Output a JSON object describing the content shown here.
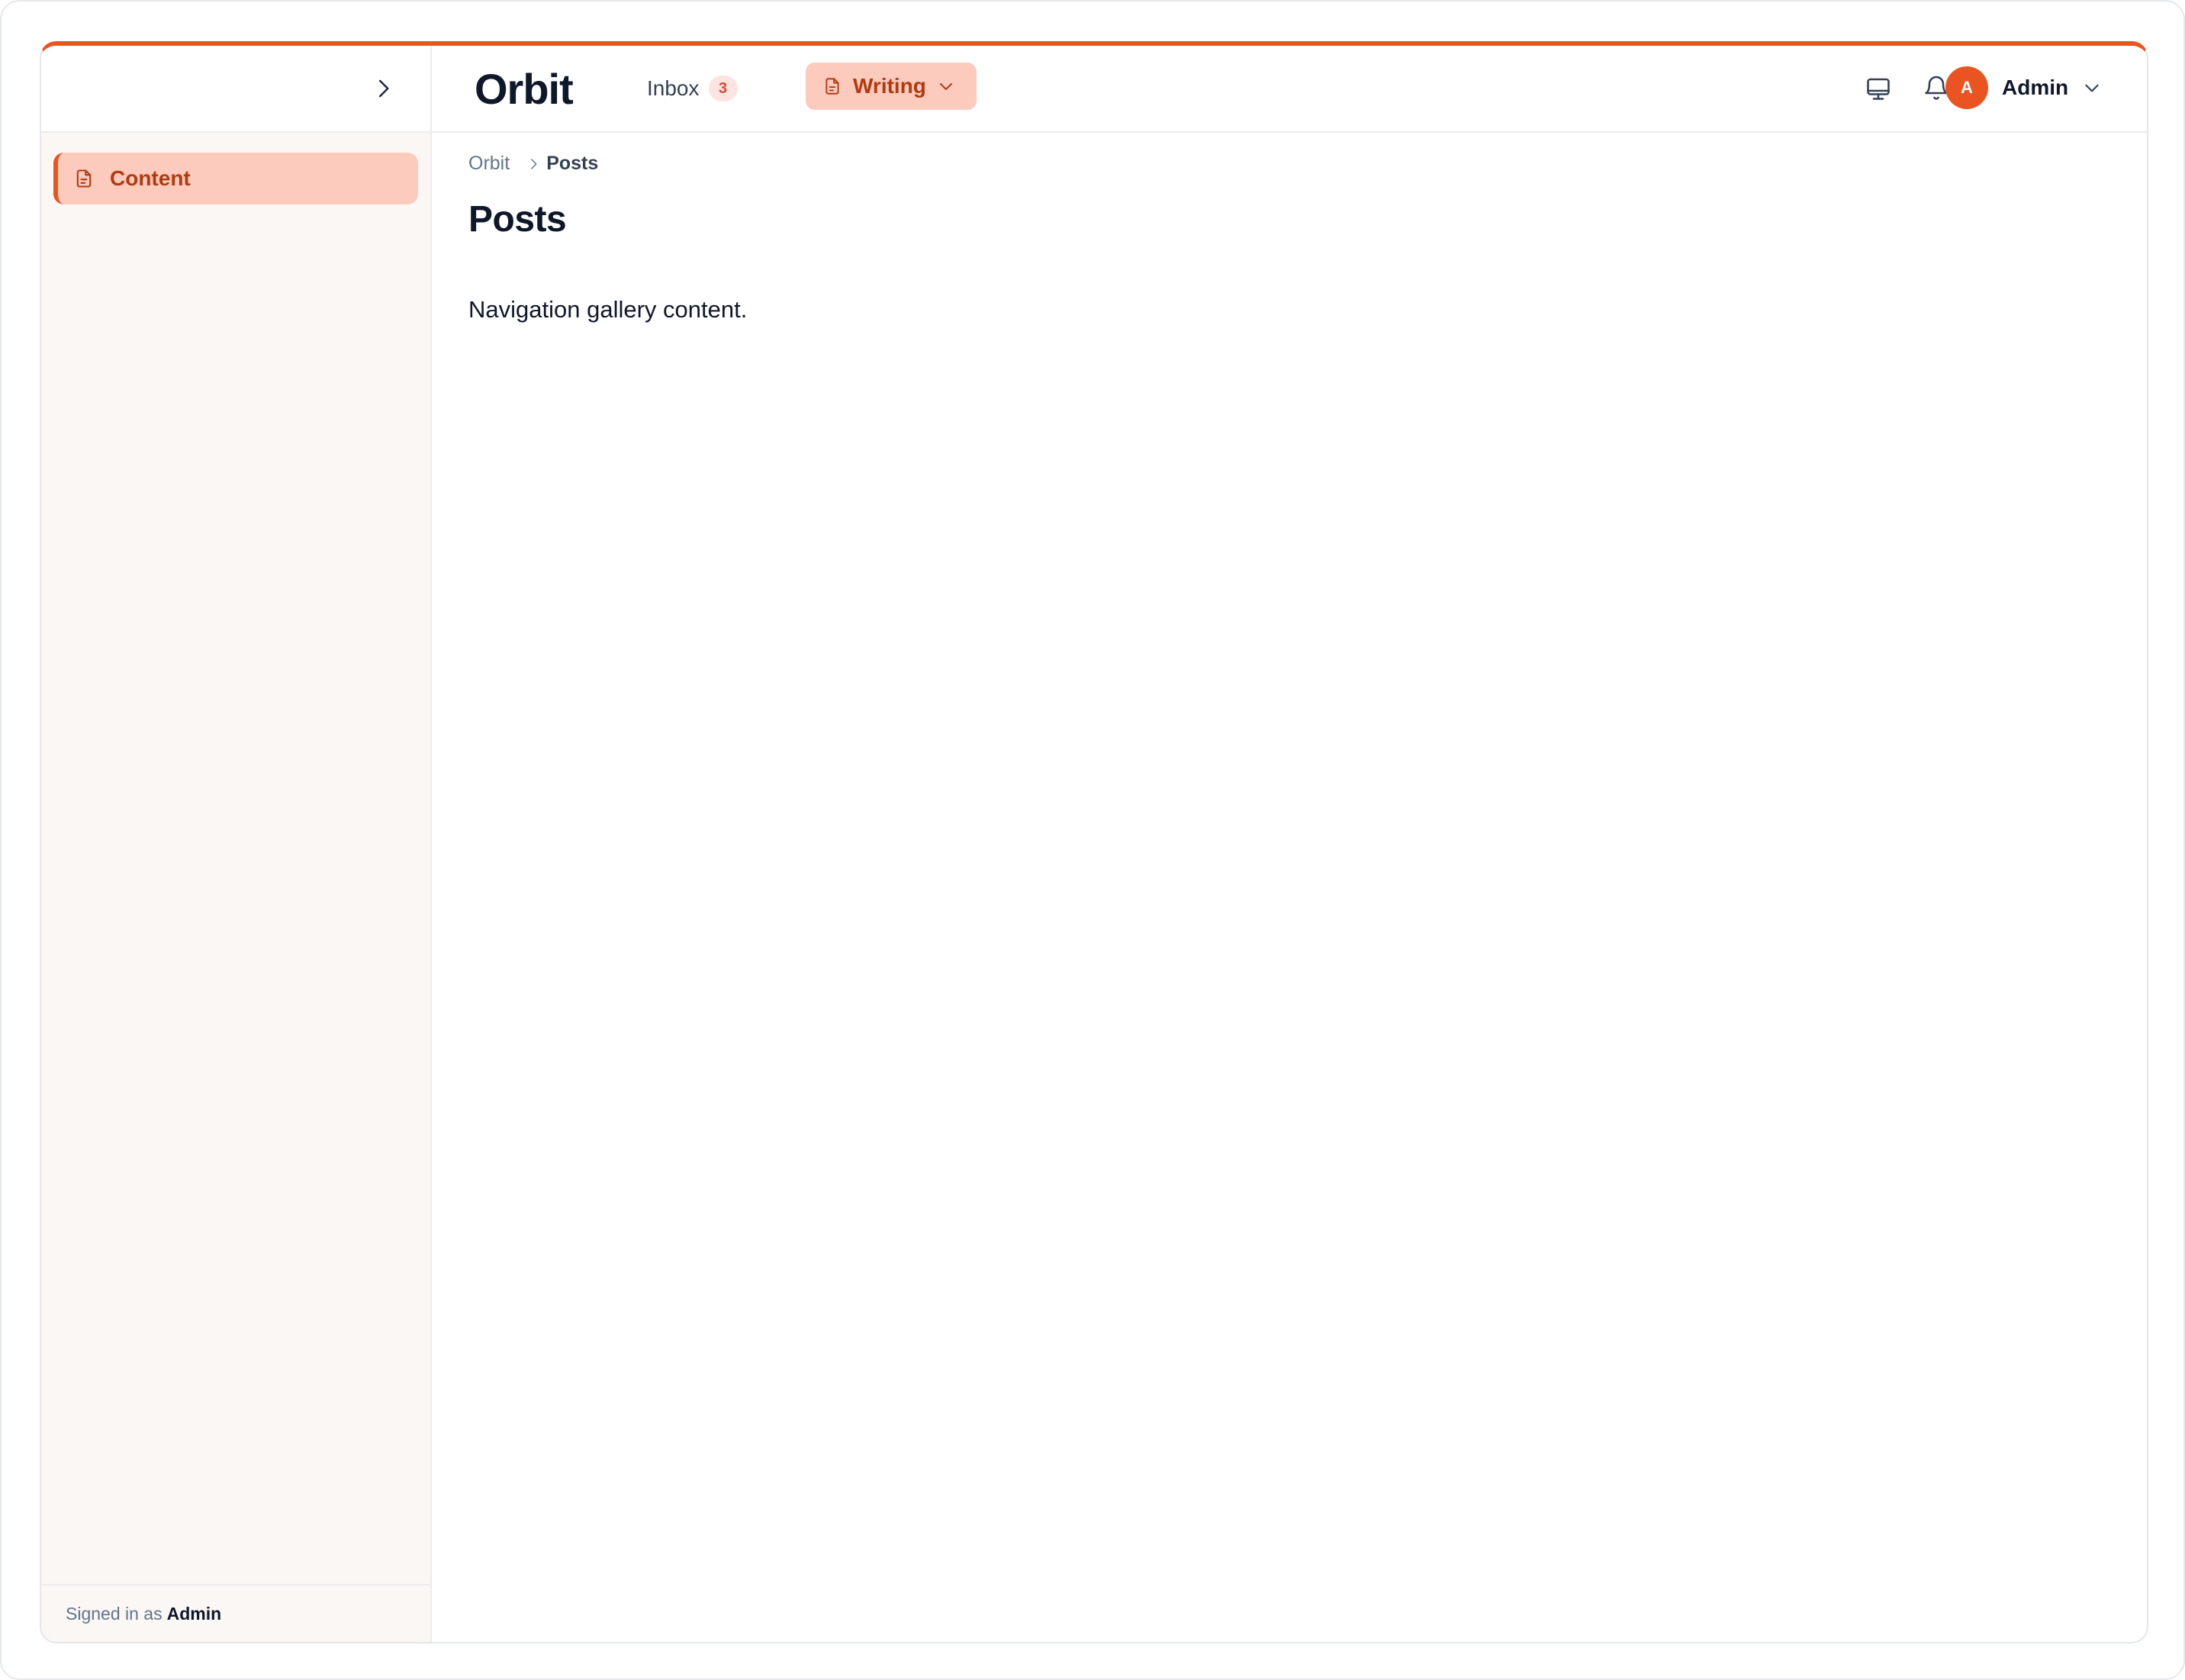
{
  "sidebar": {
    "items": [
      {
        "label": "Content",
        "icon": "document-icon",
        "active": true
      }
    ],
    "footer": {
      "prefix": "Signed in as",
      "user": "Admin"
    }
  },
  "header": {
    "brand": "Orbit",
    "tabs": [
      {
        "label": "Inbox",
        "badge": "3"
      },
      {
        "label": "Writing",
        "icon": "document-icon",
        "active": true
      }
    ],
    "user": {
      "initial": "A",
      "name": "Admin"
    }
  },
  "main": {
    "breadcrumb": [
      "Orbit",
      "Posts"
    ],
    "title": "Posts",
    "body": "Navigation gallery content."
  },
  "colors": {
    "accent": "#ea5420",
    "accent_soft": "#fccbbd",
    "accent_text": "#b23a10",
    "sidebar_bg": "#faf7f4",
    "badge_bg": "#fde4e1",
    "badge_text": "#e0453a"
  }
}
